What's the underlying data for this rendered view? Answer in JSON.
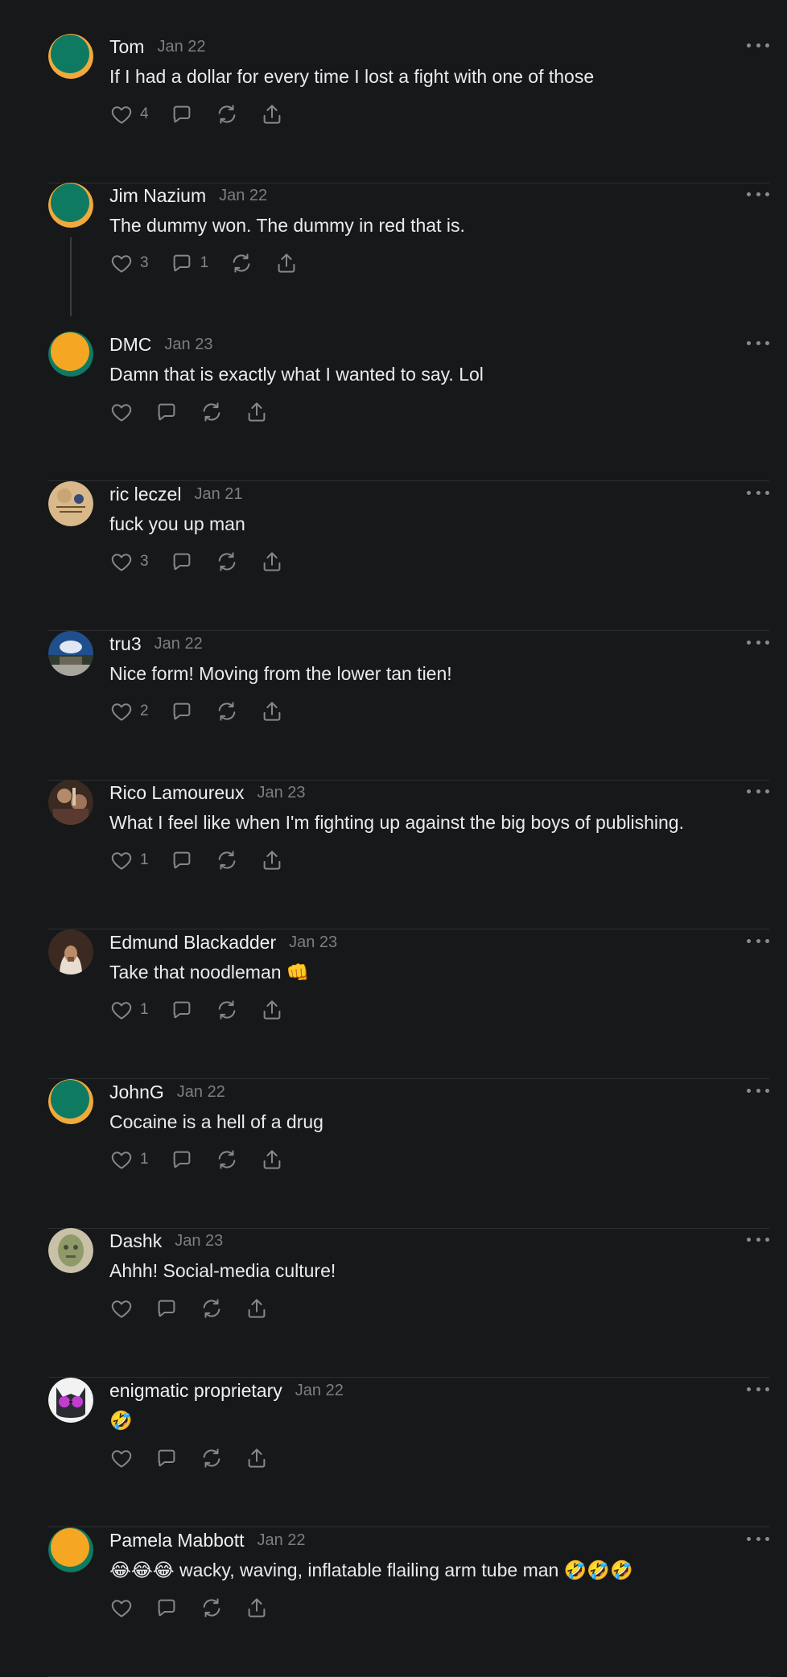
{
  "comments": [
    {
      "author": "Tom",
      "date": "Jan 22",
      "text": "If I had a dollar for every time I lost a fight with one of those",
      "likes": "4",
      "replies": "",
      "avatar": "green-orange-ring"
    },
    {
      "author": "Jim Nazium",
      "date": "Jan 22",
      "text": "The dummy won. The dummy in red that is.",
      "likes": "3",
      "replies": "1",
      "avatar": "green-orange-ring",
      "threaded": true
    },
    {
      "author": "DMC",
      "date": "Jan 23",
      "text": "Damn that is exactly what I wanted to say. Lol",
      "likes": "",
      "replies": "",
      "avatar": "orange-green-ring"
    },
    {
      "author": "ric leczel",
      "date": "Jan 21",
      "text": "fuck you up man",
      "likes": "3",
      "replies": "",
      "avatar": "tan-badge"
    },
    {
      "author": "tru3",
      "date": "Jan 22",
      "text": "Nice form! Moving from the lower tan tien!",
      "likes": "2",
      "replies": "",
      "avatar": "sky-panorama"
    },
    {
      "author": "Rico Lamoureux",
      "date": "Jan 23",
      "text": "What I feel like when I'm fighting up against the big boys of publishing.",
      "likes": "1",
      "replies": "",
      "avatar": "photo-people"
    },
    {
      "author": "Edmund Blackadder",
      "date": "Jan 23",
      "text": "Take that noodleman 👊",
      "likes": "1",
      "replies": "",
      "avatar": "photo-hooded"
    },
    {
      "author": "JohnG",
      "date": "Jan 22",
      "text": "Cocaine is a hell of a drug",
      "likes": "1",
      "replies": "",
      "avatar": "green-orange-ring"
    },
    {
      "author": "Dashk",
      "date": "Jan 23",
      "text": "Ahhh! Social-media culture!",
      "likes": "",
      "replies": "",
      "avatar": "photo-statue"
    },
    {
      "author": "enigmatic proprietary",
      "date": "Jan 22",
      "text": "🤣",
      "likes": "",
      "replies": "",
      "avatar": "photo-cat-glasses"
    },
    {
      "author": "Pamela Mabbott",
      "date": "Jan 22",
      "text": "😂😂😂 wacky, waving, inflatable flailing arm tube man 🤣🤣🤣",
      "likes": "",
      "replies": "",
      "avatar": "orange-green-ring"
    }
  ],
  "icons": {
    "like": "heart-icon",
    "reply": "comment-icon",
    "restack": "restack-icon",
    "share": "share-icon",
    "more": "more-options-icon"
  },
  "colors": {
    "background": "#17181a",
    "text": "#ebebec",
    "muted": "#7c7e83",
    "avatar_green": "#0e7a62",
    "avatar_orange": "#f5a623"
  }
}
